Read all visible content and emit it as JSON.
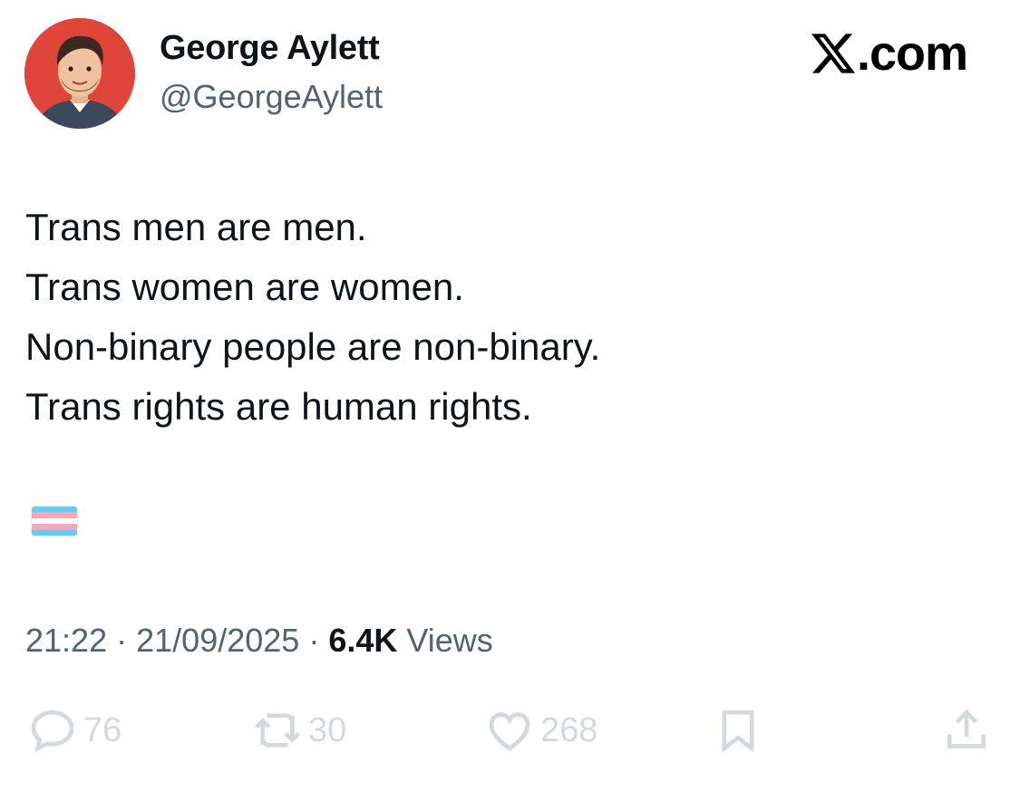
{
  "author": {
    "name": "George Aylett",
    "handle": "@GeorgeAylett",
    "avatar_icon": "profile-photo"
  },
  "brand": {
    "text": ".com",
    "icon": "x-logo-icon"
  },
  "tweet": {
    "lines": [
      "Trans men are men.",
      "Trans women are women.",
      "Non-binary people are non-binary.",
      "Trans rights are human rights."
    ],
    "emoji": "transgender-flag",
    "flag_colors": [
      "#5BCEFA",
      "#F5A9B8",
      "#FFFFFF",
      "#F5A9B8",
      "#5BCEFA"
    ]
  },
  "meta": {
    "time": "21:22",
    "date": "21/09/2025",
    "views_count": "6.4K",
    "views_label": "Views",
    "separator": "·"
  },
  "actions": {
    "replies": "76",
    "reposts": "30",
    "likes": "268"
  }
}
